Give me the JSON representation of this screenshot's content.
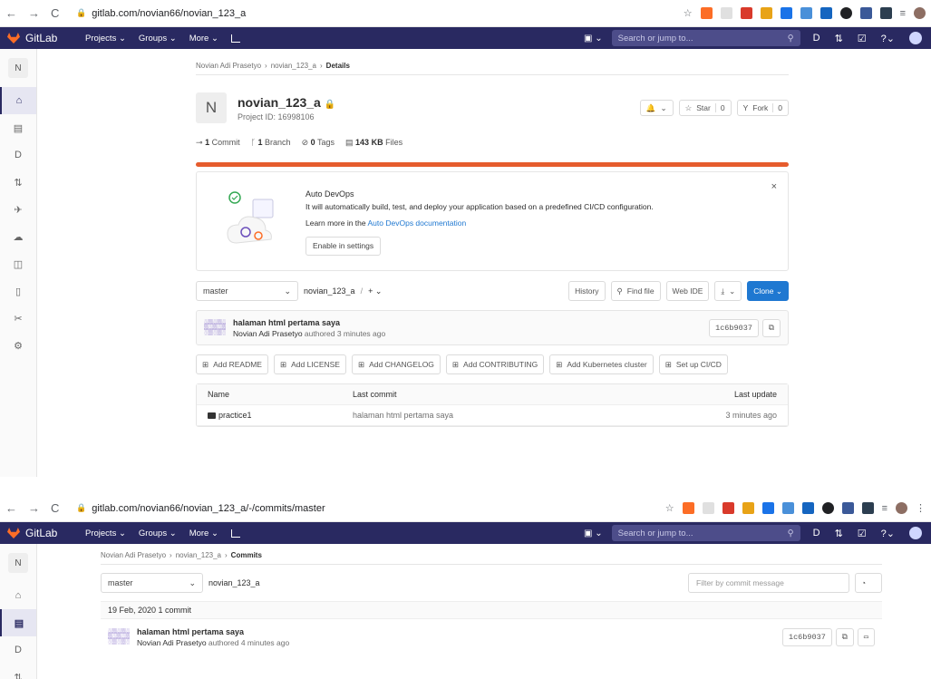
{
  "shot1": {
    "url": "gitlab.com/novian66/novian_123_a",
    "nav": {
      "logo": "GitLab",
      "projects": "Projects ⌄",
      "groups": "Groups ⌄",
      "more": "More ⌄",
      "search_placeholder": "Search or jump to..."
    },
    "sidebar_avatar": "N",
    "breadcrumb": {
      "owner": "Novian Adi Prasetyo",
      "project": "novian_123_a",
      "current": "Details"
    },
    "project": {
      "avatar": "N",
      "name": "novian_123_a",
      "id": "Project ID: 16998106"
    },
    "actions": {
      "notif": "⌄",
      "star": "Star",
      "star_count": "0",
      "fork": "Fork",
      "fork_count": "0"
    },
    "stats": {
      "commits_n": "1",
      "commits": "Commit",
      "branch_n": "1",
      "branch": "Branch",
      "tags_n": "0",
      "tags": "Tags",
      "files_n": "143 KB",
      "files": "Files"
    },
    "devops": {
      "title": "Auto DevOps",
      "desc": "It will automatically build, test, and deploy your application based on a predefined CI/CD configuration.",
      "learn_prefix": "Learn more in the ",
      "learn_link": "Auto DevOps documentation",
      "button": "Enable in settings",
      "close": "×"
    },
    "toolbar": {
      "branch": "master",
      "path": "novian_123_a",
      "sep": "/",
      "add": "+ ⌄",
      "history": "History",
      "find": "Find file",
      "webide": "Web IDE",
      "download": "⌄",
      "clone": "Clone ⌄"
    },
    "commit": {
      "message": "halaman html pertama saya",
      "author": "Novian Adi Prasetyo",
      "authored": " authored 3 minutes ago",
      "sha": "1c6b9037"
    },
    "add_buttons": [
      "Add README",
      "Add LICENSE",
      "Add CHANGELOG",
      "Add CONTRIBUTING",
      "Add Kubernetes cluster",
      "Set up CI/CD"
    ],
    "table": {
      "headers": {
        "name": "Name",
        "last_commit": "Last commit",
        "last_update": "Last update"
      },
      "rows": [
        {
          "name": "practice1",
          "commit": "halaman html pertama saya",
          "update": "3 minutes ago"
        }
      ]
    }
  },
  "shot2": {
    "url": "gitlab.com/novian66/novian_123_a/-/commits/master",
    "sidebar_avatar": "N",
    "breadcrumb": {
      "owner": "Novian Adi Prasetyo",
      "project": "novian_123_a",
      "current": "Commits"
    },
    "toolbar": {
      "branch": "master",
      "path": "novian_123_a",
      "filter_placeholder": "Filter by commit message"
    },
    "day": "19 Feb, 2020 1 commit",
    "commit": {
      "message": "halaman html pertama saya",
      "author": "Novian Adi Prasetyo",
      "authored": " authored 4 minutes ago",
      "sha": "1c6b9037"
    }
  }
}
